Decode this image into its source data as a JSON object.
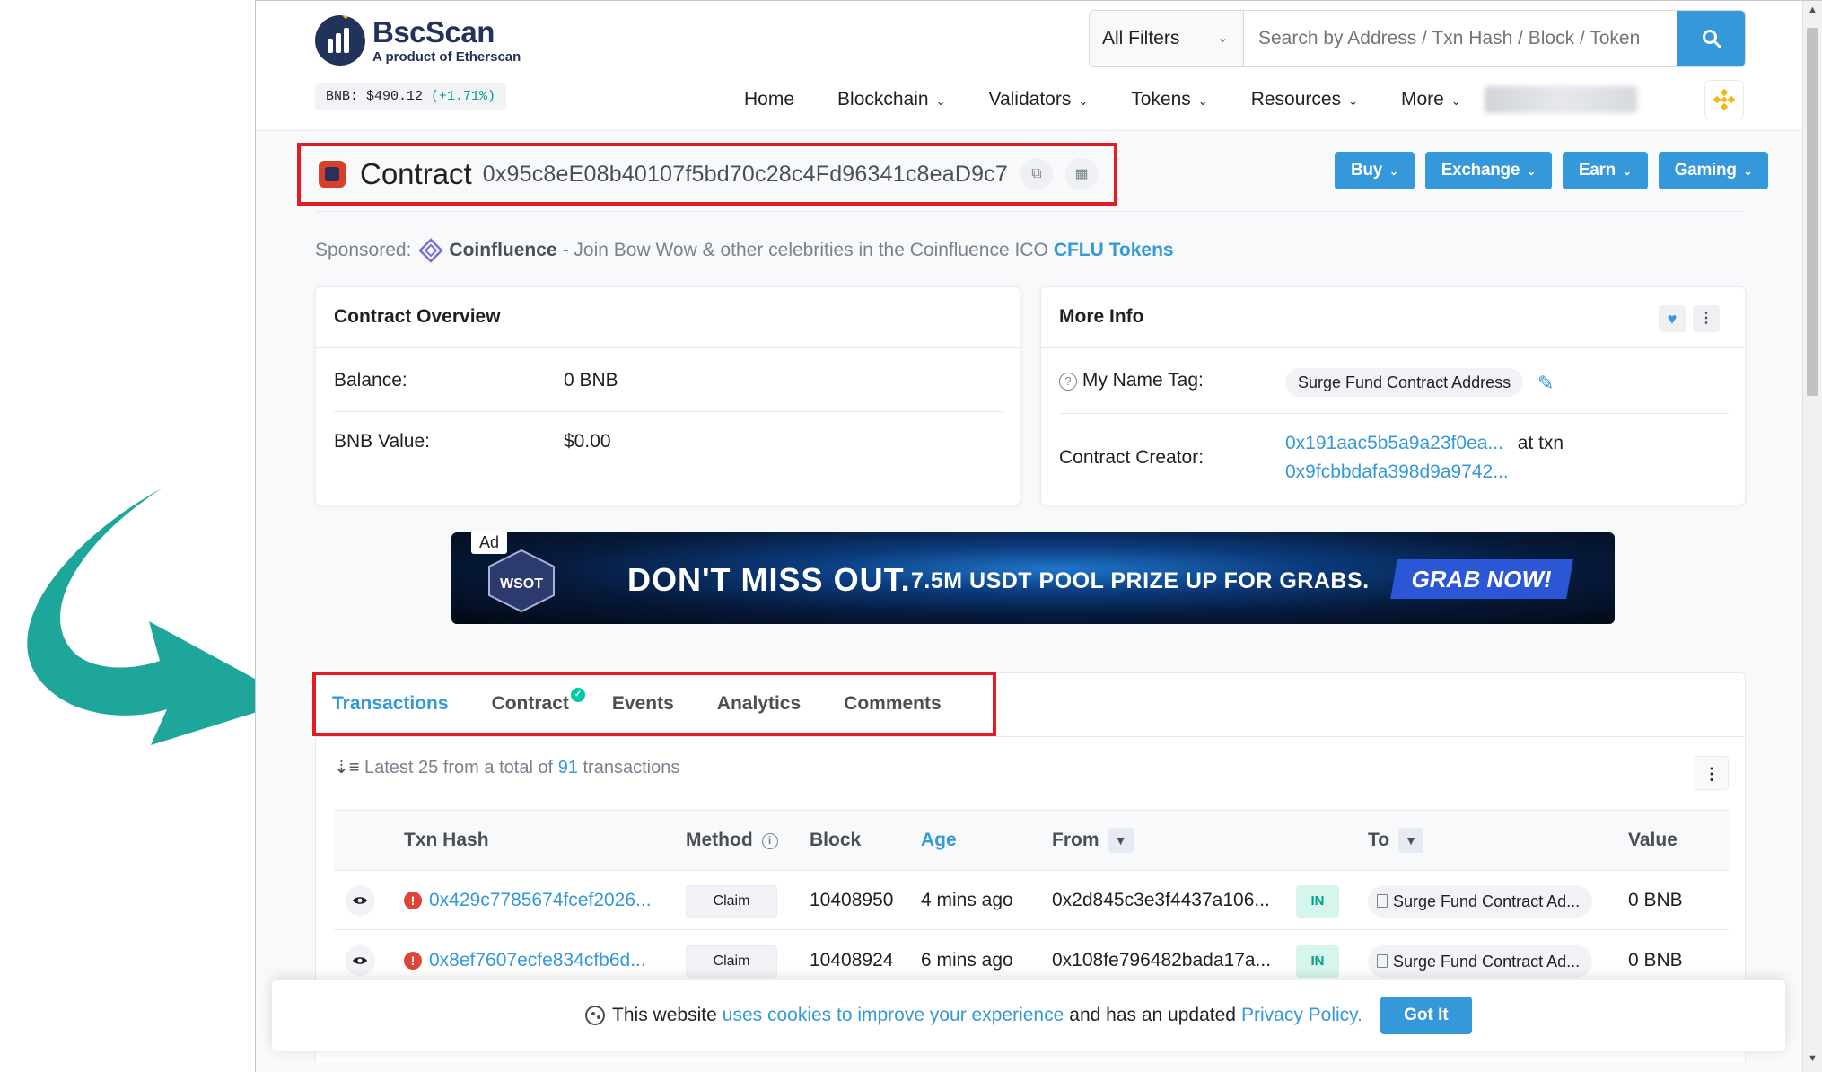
{
  "header": {
    "logo_title": "BscScan",
    "logo_subtitle": "A product of Etherscan",
    "price_label": "BNB: $490.12",
    "price_change": "(+1.71%)",
    "filter_label": "All Filters",
    "search_placeholder": "Search by Address / Txn Hash / Block / Token",
    "nav": [
      {
        "label": "Home",
        "has_dropdown": false
      },
      {
        "label": "Blockchain",
        "has_dropdown": true
      },
      {
        "label": "Validators",
        "has_dropdown": true
      },
      {
        "label": "Tokens",
        "has_dropdown": true
      },
      {
        "label": "Resources",
        "has_dropdown": true
      },
      {
        "label": "More",
        "has_dropdown": true
      }
    ]
  },
  "contract": {
    "label": "Contract",
    "address": "0x95c8eE08b40107f5bd70c28c4Fd96341c8eaD9c7"
  },
  "actions": [
    {
      "label": "Buy"
    },
    {
      "label": "Exchange"
    },
    {
      "label": "Earn"
    },
    {
      "label": "Gaming"
    }
  ],
  "sponsored": {
    "prefix": "Sponsored:",
    "brand": "Coinfluence",
    "text": "- Join Bow Wow & other celebrities in the Coinfluence ICO",
    "highlight": "CFLU Tokens"
  },
  "overview": {
    "title": "Contract Overview",
    "rows": [
      {
        "label": "Balance:",
        "value": "0 BNB"
      },
      {
        "label": "BNB Value:",
        "value": "$0.00"
      }
    ]
  },
  "more_info": {
    "title": "More Info",
    "name_tag_label": "My Name Tag:",
    "name_tag_value": "Surge Fund Contract Address",
    "creator_label": "Contract Creator:",
    "creator_address": "0x191aac5b5a9a23f0ea...",
    "creator_at": "at txn",
    "creator_txn": "0x9fcbbdafa398d9a9742..."
  },
  "ad": {
    "tag": "Ad",
    "badge_text": "WSOT",
    "headline": "DON'T MISS OUT.",
    "subline": "7.5M USDT POOL PRIZE UP FOR GRABS.",
    "cta": "GRAB NOW!"
  },
  "tabs": [
    {
      "label": "Transactions",
      "active": true
    },
    {
      "label": "Contract",
      "active": false,
      "verified": true
    },
    {
      "label": "Events",
      "active": false
    },
    {
      "label": "Analytics",
      "active": false
    },
    {
      "label": "Comments",
      "active": false
    }
  ],
  "summary": {
    "prefix": "Latest 25 from a total of",
    "count": "91",
    "suffix": "transactions"
  },
  "table": {
    "columns": [
      "Txn Hash",
      "Method",
      "Block",
      "Age",
      "From",
      "To",
      "Value"
    ],
    "rows": [
      {
        "hash": "0x429c7785674fcef2026...",
        "method": "Claim",
        "block": "10408950",
        "age": "4 mins ago",
        "from": "0x2d845c3e3f4437a106...",
        "dir": "IN",
        "to": "Surge Fund Contract Ad...",
        "value": "0 BNB"
      },
      {
        "hash": "0x8ef7607ecfe834cfb6d...",
        "method": "Claim",
        "block": "10408924",
        "age": "6 mins ago",
        "from": "0x108fe796482bada17a...",
        "dir": "IN",
        "to": "Surge Fund Contract Ad...",
        "value": "0 BNB"
      }
    ]
  },
  "cookie": {
    "prefix": "This website",
    "link1": "uses cookies to improve your experience",
    "middle": "and has an updated",
    "link2": "Privacy Policy.",
    "button": "Got It"
  },
  "colors": {
    "accent": "#3498db",
    "highlight_box": "#e31b23",
    "arrow": "#1fa69a",
    "positive": "#00a186"
  }
}
